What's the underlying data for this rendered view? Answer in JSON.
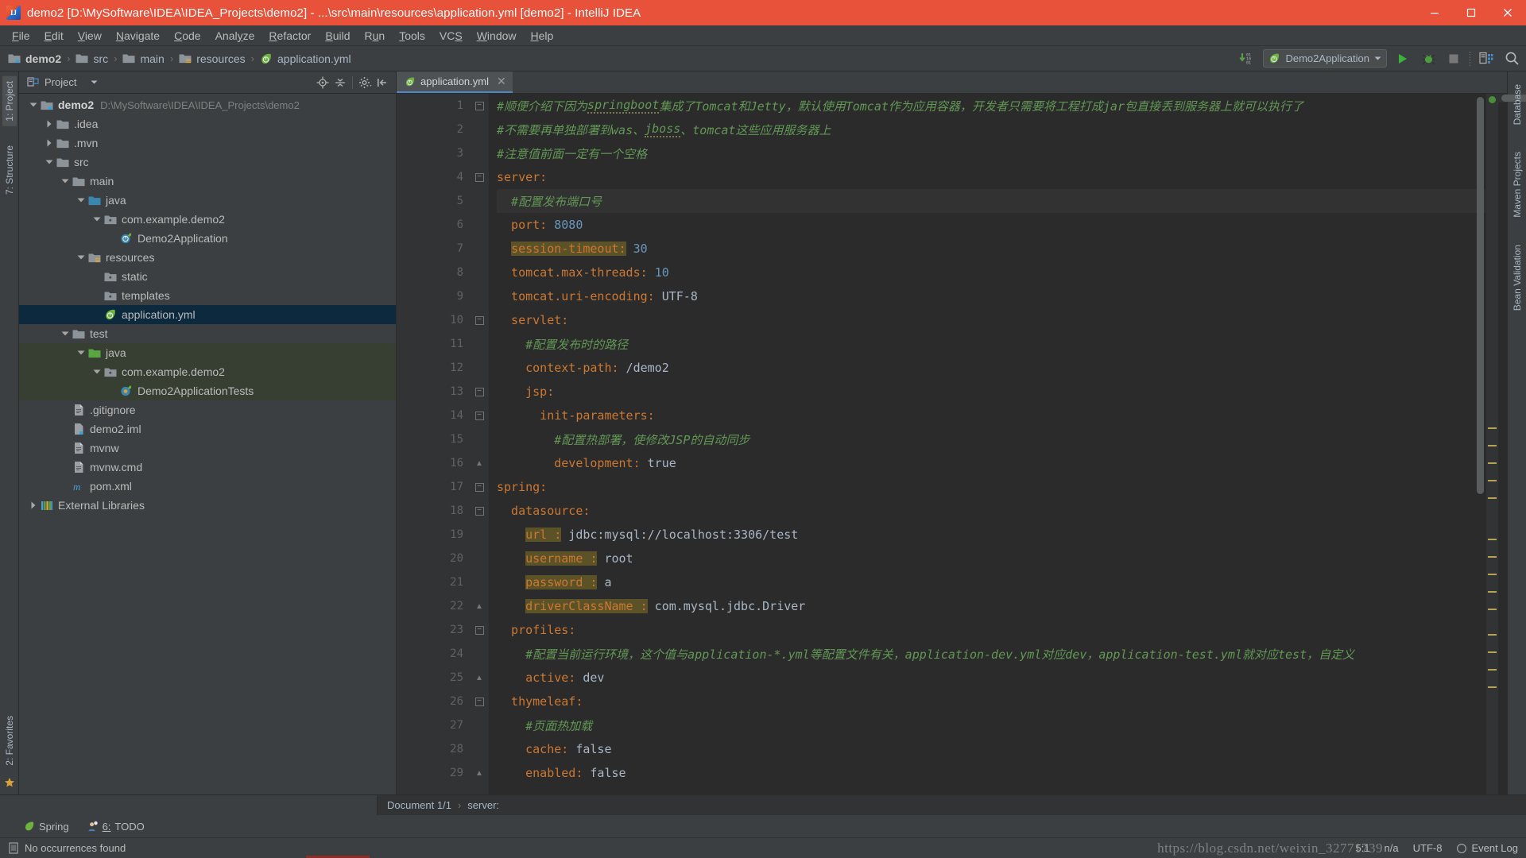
{
  "window": {
    "title": "demo2 [D:\\MySoftware\\IDEA\\IDEA_Projects\\demo2] - ...\\src\\main\\resources\\application.yml [demo2] - IntelliJ IDEA",
    "logo_text": "IJ",
    "minimize": "minimize-icon",
    "maximize": "maximize-icon",
    "close": "close-icon"
  },
  "menubar": [
    {
      "label": "File",
      "mnemonic": "F"
    },
    {
      "label": "Edit",
      "mnemonic": "E"
    },
    {
      "label": "View",
      "mnemonic": "V"
    },
    {
      "label": "Navigate",
      "mnemonic": "N"
    },
    {
      "label": "Code",
      "mnemonic": "C"
    },
    {
      "label": "Analyze",
      "mnemonic": "y"
    },
    {
      "label": "Refactor",
      "mnemonic": "R"
    },
    {
      "label": "Build",
      "mnemonic": "B"
    },
    {
      "label": "Run",
      "mnemonic": "u"
    },
    {
      "label": "Tools",
      "mnemonic": "T"
    },
    {
      "label": "VCS",
      "mnemonic": "S"
    },
    {
      "label": "Window",
      "mnemonic": "W"
    },
    {
      "label": "Help",
      "mnemonic": "H"
    }
  ],
  "toolbar": {
    "breadcrumbs": [
      {
        "label": "demo2",
        "icon": "module-folder-icon",
        "bold": true
      },
      {
        "label": "src",
        "icon": "folder-icon",
        "bold": false
      },
      {
        "label": "main",
        "icon": "folder-icon",
        "bold": false
      },
      {
        "label": "resources",
        "icon": "resources-folder-icon",
        "bold": false
      },
      {
        "label": "application.yml",
        "icon": "spring-yml-icon",
        "bold": false
      }
    ],
    "separator": "›",
    "update_icon": "download-updates-icon",
    "run_config": {
      "label": "Demo2Application",
      "icon": "spring-boot-icon",
      "dropdown": "chevron-down-icon"
    },
    "run_button": "run-icon",
    "debug_button": "debug-icon",
    "stop_button": "stop-icon",
    "layout_button": "layout-icon",
    "search_button": "search-everywhere-icon"
  },
  "left_strip": {
    "tabs": [
      {
        "label": "1: Project",
        "active": true
      },
      {
        "label": "7: Structure",
        "active": false
      }
    ],
    "bottom_tabs": [
      {
        "label": "2: Favorites",
        "active": false
      }
    ],
    "bookmark_icon": "bookmark-star-icon"
  },
  "right_strip": {
    "tabs": [
      {
        "label": "Database"
      },
      {
        "label": "Maven Projects"
      },
      {
        "label": "Bean Validation"
      }
    ]
  },
  "project_pane": {
    "title": "Project",
    "dropdown": "chevron-down-icon",
    "actions": [
      "locate-icon",
      "collapse-all-icon",
      "settings-icon",
      "hide-icon"
    ],
    "tree": [
      {
        "depth": 0,
        "arrow": "down",
        "icon": "module-folder-icon",
        "label": "demo2",
        "bold": true,
        "sub": "D:\\MySoftware\\IDEA\\IDEA_Projects\\demo2",
        "state": "normal"
      },
      {
        "depth": 1,
        "arrow": "right",
        "icon": "folder-icon",
        "label": ".idea",
        "bold": false,
        "sub": "",
        "state": "normal"
      },
      {
        "depth": 1,
        "arrow": "right",
        "icon": "folder-icon",
        "label": ".mvn",
        "bold": false,
        "sub": "",
        "state": "normal"
      },
      {
        "depth": 1,
        "arrow": "down",
        "icon": "folder-icon",
        "label": "src",
        "bold": false,
        "sub": "",
        "state": "normal"
      },
      {
        "depth": 2,
        "arrow": "down",
        "icon": "folder-icon",
        "label": "main",
        "bold": false,
        "sub": "",
        "state": "normal"
      },
      {
        "depth": 3,
        "arrow": "down",
        "icon": "source-folder-icon",
        "label": "java",
        "bold": false,
        "sub": "",
        "state": "normal"
      },
      {
        "depth": 4,
        "arrow": "down",
        "icon": "package-icon",
        "label": "com.example.demo2",
        "bold": false,
        "sub": "",
        "state": "normal"
      },
      {
        "depth": 5,
        "arrow": "none",
        "icon": "spring-class-icon",
        "label": "Demo2Application",
        "bold": false,
        "sub": "",
        "state": "normal"
      },
      {
        "depth": 3,
        "arrow": "down",
        "icon": "resources-folder-icon",
        "label": "resources",
        "bold": false,
        "sub": "",
        "state": "normal"
      },
      {
        "depth": 4,
        "arrow": "none",
        "icon": "package-icon",
        "label": "static",
        "bold": false,
        "sub": "",
        "state": "normal"
      },
      {
        "depth": 4,
        "arrow": "none",
        "icon": "package-icon",
        "label": "templates",
        "bold": false,
        "sub": "",
        "state": "normal"
      },
      {
        "depth": 4,
        "arrow": "none",
        "icon": "spring-yml-icon",
        "label": "application.yml",
        "bold": false,
        "sub": "",
        "state": "selected"
      },
      {
        "depth": 2,
        "arrow": "down",
        "icon": "folder-icon",
        "label": "test",
        "bold": false,
        "sub": "",
        "state": "normal"
      },
      {
        "depth": 3,
        "arrow": "down",
        "icon": "test-source-folder-icon",
        "label": "java",
        "bold": false,
        "sub": "",
        "state": "testsrc"
      },
      {
        "depth": 4,
        "arrow": "down",
        "icon": "package-icon",
        "label": "com.example.demo2",
        "bold": false,
        "sub": "",
        "state": "testsrc"
      },
      {
        "depth": 5,
        "arrow": "none",
        "icon": "test-class-icon",
        "label": "Demo2ApplicationTests",
        "bold": false,
        "sub": "",
        "state": "testsrc"
      },
      {
        "depth": 2,
        "arrow": "none",
        "icon": "file-icon",
        "label": ".gitignore",
        "bold": false,
        "sub": "",
        "state": "normal"
      },
      {
        "depth": 2,
        "arrow": "none",
        "icon": "iml-file-icon",
        "label": "demo2.iml",
        "bold": false,
        "sub": "",
        "state": "normal"
      },
      {
        "depth": 2,
        "arrow": "none",
        "icon": "file-icon",
        "label": "mvnw",
        "bold": false,
        "sub": "",
        "state": "normal"
      },
      {
        "depth": 2,
        "arrow": "none",
        "icon": "file-icon",
        "label": "mvnw.cmd",
        "bold": false,
        "sub": "",
        "state": "normal"
      },
      {
        "depth": 2,
        "arrow": "none",
        "icon": "maven-file-icon",
        "label": "pom.xml",
        "bold": false,
        "sub": "",
        "state": "normal"
      },
      {
        "depth": 0,
        "arrow": "right",
        "icon": "libraries-icon",
        "label": "External Libraries",
        "bold": false,
        "sub": "",
        "state": "normal"
      }
    ]
  },
  "editor": {
    "tab": {
      "label": "application.yml",
      "icon": "spring-yml-icon",
      "close": "close-icon"
    },
    "lines": [
      {
        "n": 1,
        "fold": "start-open",
        "caret": false,
        "parts": [
          {
            "t": "#顺便介绍下因为",
            "c": "comment"
          },
          {
            "t": "springboot",
            "c": "comment-squig"
          },
          {
            "t": "集成了Tomcat和Jetty，默认使用Tomcat作为应用容器，开发者只需要将工程打成jar包直接丢到服务器上就可以执行了",
            "c": "comment"
          }
        ]
      },
      {
        "n": 2,
        "fold": "none",
        "caret": false,
        "parts": [
          {
            "t": "#不需要再单独部署到was、",
            "c": "comment"
          },
          {
            "t": "jboss",
            "c": "comment-squig"
          },
          {
            "t": "、tomcat这些应用服务器上",
            "c": "comment"
          }
        ]
      },
      {
        "n": 3,
        "fold": "none",
        "caret": false,
        "parts": [
          {
            "t": "#注意值前面一定有一个空格",
            "c": "comment"
          }
        ]
      },
      {
        "n": 4,
        "fold": "start",
        "caret": false,
        "parts": [
          {
            "t": "server:",
            "c": "key"
          }
        ]
      },
      {
        "n": 5,
        "fold": "none",
        "caret": true,
        "parts": [
          {
            "t": "  #配置发布端口号",
            "c": "comment"
          }
        ]
      },
      {
        "n": 6,
        "fold": "none",
        "caret": false,
        "parts": [
          {
            "t": "  port:",
            "c": "key"
          },
          {
            "t": " ",
            "c": "val"
          },
          {
            "t": "8080",
            "c": "num"
          }
        ]
      },
      {
        "n": 7,
        "fold": "none",
        "caret": false,
        "parts": [
          {
            "t": "  ",
            "c": "val"
          },
          {
            "t": "session-timeout:",
            "c": "key-hl"
          },
          {
            "t": " ",
            "c": "val"
          },
          {
            "t": "30",
            "c": "num"
          }
        ]
      },
      {
        "n": 8,
        "fold": "none",
        "caret": false,
        "parts": [
          {
            "t": "  tomcat.max-threads:",
            "c": "key"
          },
          {
            "t": " ",
            "c": "val"
          },
          {
            "t": "10",
            "c": "num"
          }
        ]
      },
      {
        "n": 9,
        "fold": "none",
        "caret": false,
        "parts": [
          {
            "t": "  tomcat.uri-encoding:",
            "c": "key"
          },
          {
            "t": " UTF-8",
            "c": "val"
          }
        ]
      },
      {
        "n": 10,
        "fold": "start",
        "caret": false,
        "parts": [
          {
            "t": "  servlet:",
            "c": "key"
          }
        ]
      },
      {
        "n": 11,
        "fold": "none",
        "caret": false,
        "parts": [
          {
            "t": "    #配置发布时的路径",
            "c": "comment"
          }
        ]
      },
      {
        "n": 12,
        "fold": "none",
        "caret": false,
        "parts": [
          {
            "t": "    context-path:",
            "c": "key"
          },
          {
            "t": " /demo2",
            "c": "val"
          }
        ]
      },
      {
        "n": 13,
        "fold": "start",
        "caret": false,
        "parts": [
          {
            "t": "    jsp:",
            "c": "key"
          }
        ]
      },
      {
        "n": 14,
        "fold": "start",
        "caret": false,
        "parts": [
          {
            "t": "      init-parameters:",
            "c": "key"
          }
        ]
      },
      {
        "n": 15,
        "fold": "none",
        "caret": false,
        "parts": [
          {
            "t": "        #配置热部署，使修改JSP的自动同步",
            "c": "comment"
          }
        ]
      },
      {
        "n": 16,
        "fold": "end",
        "caret": false,
        "parts": [
          {
            "t": "        development:",
            "c": "key"
          },
          {
            "t": " true",
            "c": "val"
          }
        ]
      },
      {
        "n": 17,
        "fold": "start",
        "caret": false,
        "parts": [
          {
            "t": "spring:",
            "c": "key"
          }
        ]
      },
      {
        "n": 18,
        "fold": "start",
        "caret": false,
        "parts": [
          {
            "t": "  datasource:",
            "c": "key"
          }
        ]
      },
      {
        "n": 19,
        "fold": "none",
        "caret": false,
        "parts": [
          {
            "t": "    ",
            "c": "val"
          },
          {
            "t": "url :",
            "c": "key-hl"
          },
          {
            "t": " jdbc:mysql://localhost:3306/test",
            "c": "val"
          }
        ]
      },
      {
        "n": 20,
        "fold": "none",
        "caret": false,
        "parts": [
          {
            "t": "    ",
            "c": "val"
          },
          {
            "t": "username :",
            "c": "key-hl"
          },
          {
            "t": " root",
            "c": "val"
          }
        ]
      },
      {
        "n": 21,
        "fold": "none",
        "caret": false,
        "parts": [
          {
            "t": "    ",
            "c": "val"
          },
          {
            "t": "password :",
            "c": "key-hl"
          },
          {
            "t": " a",
            "c": "val"
          }
        ]
      },
      {
        "n": 22,
        "fold": "end",
        "caret": false,
        "parts": [
          {
            "t": "    ",
            "c": "val"
          },
          {
            "t": "driverClassName :",
            "c": "key-hl"
          },
          {
            "t": " com.mysql.jdbc.Driver",
            "c": "val"
          }
        ]
      },
      {
        "n": 23,
        "fold": "start",
        "caret": false,
        "parts": [
          {
            "t": "  profiles:",
            "c": "key"
          }
        ]
      },
      {
        "n": 24,
        "fold": "none",
        "caret": false,
        "parts": [
          {
            "t": "    #配置当前运行环境，这个值与application-*.yml等配置文件有关，application-dev.yml对应dev，application-test.yml就对应test，自定义",
            "c": "comment"
          }
        ]
      },
      {
        "n": 25,
        "fold": "end",
        "caret": false,
        "parts": [
          {
            "t": "    active:",
            "c": "key"
          },
          {
            "t": " dev",
            "c": "val"
          }
        ]
      },
      {
        "n": 26,
        "fold": "start",
        "caret": false,
        "parts": [
          {
            "t": "  thymeleaf:",
            "c": "key"
          }
        ]
      },
      {
        "n": 27,
        "fold": "none",
        "caret": false,
        "parts": [
          {
            "t": "    #页面热加载",
            "c": "comment"
          }
        ]
      },
      {
        "n": 28,
        "fold": "none",
        "caret": false,
        "parts": [
          {
            "t": "    cache:",
            "c": "key"
          },
          {
            "t": " false",
            "c": "val"
          }
        ]
      },
      {
        "n": 29,
        "fold": "end",
        "caret": false,
        "parts": [
          {
            "t": "    enabled:",
            "c": "key"
          },
          {
            "t": " false",
            "c": "val"
          }
        ]
      }
    ]
  },
  "bottom_breadcrumb": {
    "document": "Document 1/1",
    "separator": "›",
    "node": "server:"
  },
  "tool_buttons": [
    {
      "label": "Spring",
      "icon": "spring-leaf-icon"
    },
    {
      "label": "6: TODO",
      "icon": "todo-icon",
      "mnemonic": "6:"
    }
  ],
  "statusbar": {
    "message": "No occurrences found",
    "message_icon": "document-icon",
    "caret": "5:1",
    "line_separator": "n/a",
    "encoding": "UTF-8",
    "event_log": "Event Log",
    "event_log_icon": "event-log-icon",
    "watermark": "https://blog.csdn.net/weixin_32771739"
  },
  "colors": {
    "titlebar": "#e8523a",
    "chrome": "#3c3f41",
    "editor_bg": "#2b2b2b",
    "gutter_bg": "#313335",
    "selection": "#0d293e",
    "test_source": "#373f33",
    "key": "#cc7832",
    "comment": "#629755",
    "number": "#6897bb",
    "value": "#a9b7c6",
    "highlight": "#5b5228",
    "accent_blue": "#4a88c7",
    "run_green": "#4a9c3c"
  }
}
